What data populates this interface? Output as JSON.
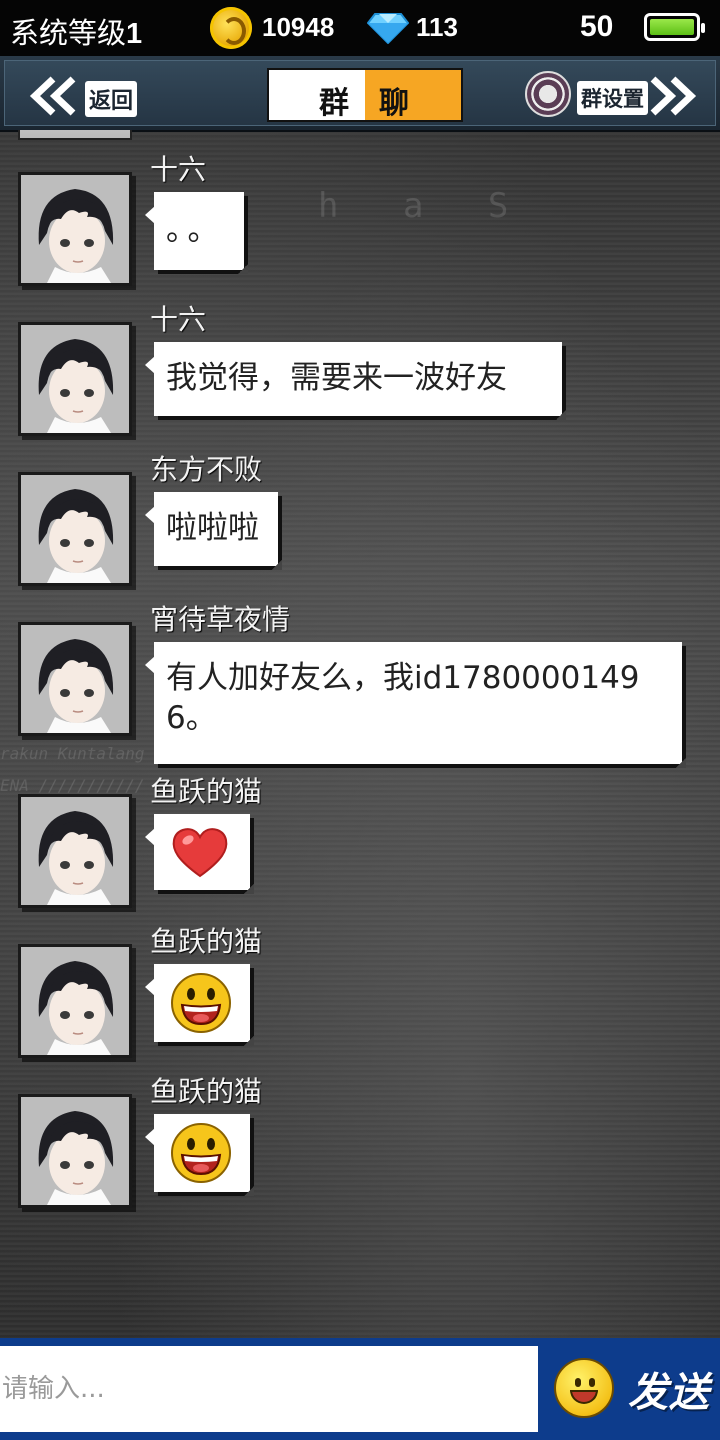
{
  "status": {
    "level_label": "系统等级",
    "level_value": "1",
    "coins": "10948",
    "gems": "113",
    "battery": "50"
  },
  "header": {
    "back_label": "返回",
    "title_left": "群",
    "title_right": "聊",
    "settings_label": "群设置"
  },
  "messages": [
    {
      "name": "十六",
      "text": "。。"
    },
    {
      "name": "十六",
      "text": "我觉得，需要来一波好友"
    },
    {
      "name": "东方不败",
      "text": "啦啦啦"
    },
    {
      "name": "宵待草夜情",
      "text": "有人加好友么，我id17800001496。"
    },
    {
      "name": "鱼跃的猫",
      "sticker": "heart-icon"
    },
    {
      "name": "鱼跃的猫",
      "sticker": "grin-emoji-icon"
    },
    {
      "name": "鱼跃的猫",
      "sticker": "grin-emoji-icon"
    }
  ],
  "input": {
    "placeholder": "请输入..."
  },
  "send_label": "发送"
}
